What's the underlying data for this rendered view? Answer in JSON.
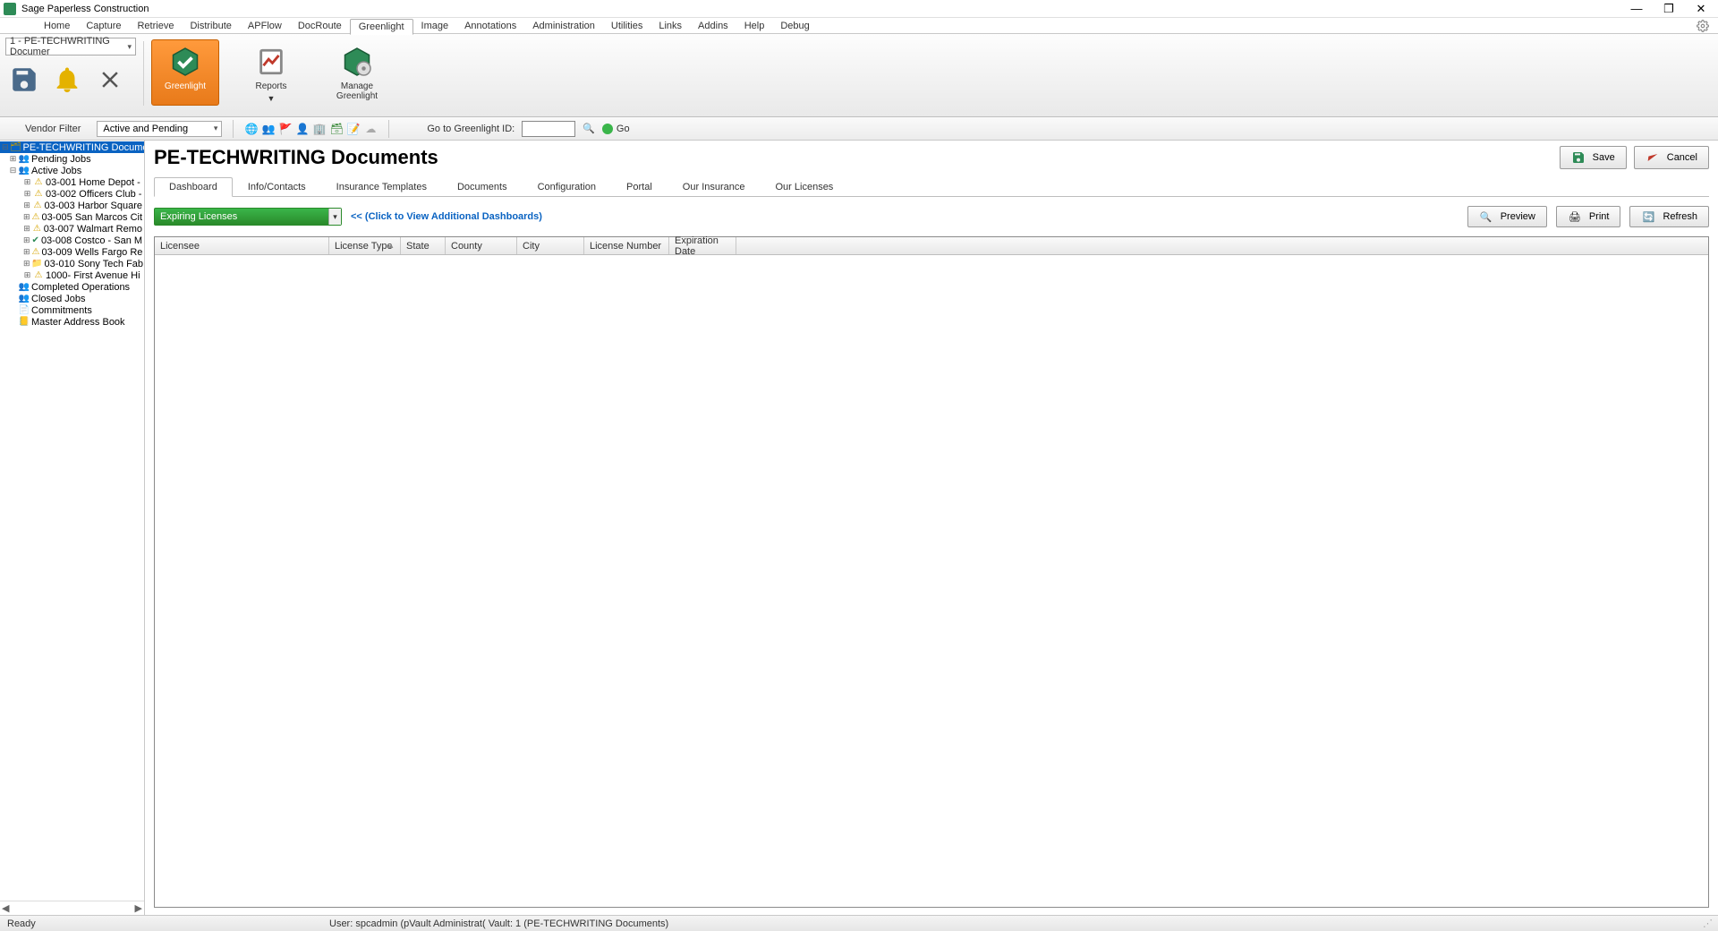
{
  "app_title": "Sage Paperless Construction",
  "window_controls": {
    "min": "—",
    "max": "❐",
    "close": "✕"
  },
  "menubar": [
    "Home",
    "Capture",
    "Retrieve",
    "Distribute",
    "APFlow",
    "DocRoute",
    "Greenlight",
    "Image",
    "Annotations",
    "Administration",
    "Utilities",
    "Links",
    "Addins",
    "Help",
    "Debug"
  ],
  "menubar_active": "Greenlight",
  "doc_selector": "1 - PE-TECHWRITING Documer",
  "ribbon": {
    "greenlight": "Greenlight",
    "reports": "Reports",
    "manage": "Manage Greenlight"
  },
  "filterbar": {
    "vendor_label": "Vendor Filter",
    "vendor_value": "Active and Pending",
    "goto_label": "Go to Greenlight ID:",
    "go": "Go"
  },
  "tree": {
    "root": "PE-TECHWRITING Documents",
    "pending": "Pending Jobs",
    "active": "Active Jobs",
    "jobs": [
      "03-001  Home Depot -",
      "03-002  Officers Club -",
      "03-003  Harbor Square",
      "03-005  San Marcos Cit",
      "03-007  Walmart Remo",
      "03-008  Costco - San M",
      "03-009  Wells Fargo Re",
      "03-010  Sony Tech Fab",
      "1000-  First  Avenue Hi"
    ],
    "completed": "Completed Operations",
    "closed": "Closed Jobs",
    "commitments": "Commitments",
    "master": "Master Address Book"
  },
  "page_title": "PE-TECHWRITING Documents",
  "header_buttons": {
    "save": "Save",
    "cancel": "Cancel"
  },
  "tabs": [
    "Dashboard",
    "Info/Contacts",
    "Insurance Templates",
    "Documents",
    "Configuration",
    "Portal",
    "Our Insurance",
    "Our Licenses"
  ],
  "tabs_active": "Dashboard",
  "dashboard": {
    "select_value": "Expiring Licenses",
    "link_prefix": "<<  ",
    "link_text": "(Click to View Additional Dashboards)",
    "preview": "Preview",
    "print": "Print",
    "refresh": "Refresh"
  },
  "grid_columns": [
    "Licensee",
    "License Type",
    "State",
    "County",
    "City",
    "License Number",
    "Expiration Date"
  ],
  "grid_col_widths": [
    195,
    80,
    50,
    80,
    75,
    95,
    75
  ],
  "status": {
    "ready": "Ready",
    "user": "User: spcadmin (pVault Administrat( Vault: 1 (PE-TECHWRITING Documents)"
  }
}
